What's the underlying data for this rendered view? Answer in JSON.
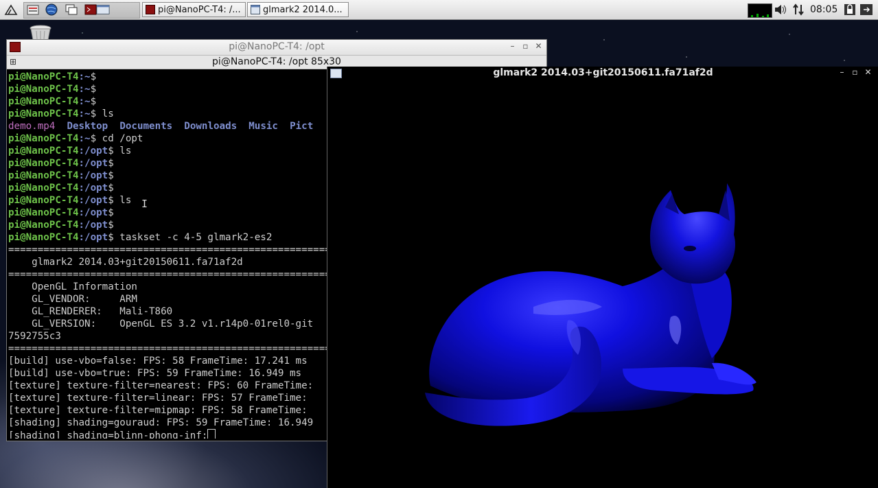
{
  "taskbar": {
    "task_buttons": [
      {
        "label": "pi@NanoPC-T4: /..."
      },
      {
        "label": "glmark2 2014.0..."
      }
    ],
    "clock": "08:05",
    "icons": [
      "start-menu-icon",
      "file-manager-icon",
      "browser-icon",
      "windows-icon",
      "terminal-icon",
      "window-switch-icon",
      "network-graph-icon",
      "volume-icon",
      "network-icon",
      "lock-icon",
      "power-icon"
    ]
  },
  "terminal": {
    "title": "pi@NanoPC-T4: /opt",
    "subtitle": "pi@NanoPC-T4: /opt 85x30",
    "lines": [
      {
        "host": "pi@NanoPC-T4",
        "path": ":~",
        "cmd": "$"
      },
      {
        "host": "pi@NanoPC-T4",
        "path": ":~",
        "cmd": "$"
      },
      {
        "host": "pi@NanoPC-T4",
        "path": ":~",
        "cmd": "$"
      },
      {
        "host": "pi@NanoPC-T4",
        "path": ":~",
        "cmd": "$ ls"
      }
    ],
    "ls_output": [
      "demo.mp4",
      "Desktop",
      "Documents",
      "Downloads",
      "Music",
      "Pict"
    ],
    "lines2": [
      {
        "host": "pi@NanoPC-T4",
        "path": ":~",
        "cmd": "$ cd /opt"
      },
      {
        "host": "pi@NanoPC-T4",
        "path": ":/opt",
        "cmd": "$ ls"
      },
      {
        "host": "pi@NanoPC-T4",
        "path": ":/opt",
        "cmd": "$"
      },
      {
        "host": "pi@NanoPC-T4",
        "path": ":/opt",
        "cmd": "$"
      },
      {
        "host": "pi@NanoPC-T4",
        "path": ":/opt",
        "cmd": "$"
      },
      {
        "host": "pi@NanoPC-T4",
        "path": ":/opt",
        "cmd": "$ ls"
      },
      {
        "host": "pi@NanoPC-T4",
        "path": ":/opt",
        "cmd": "$"
      },
      {
        "host": "pi@NanoPC-T4",
        "path": ":/opt",
        "cmd": "$"
      },
      {
        "host": "pi@NanoPC-T4",
        "path": ":/opt",
        "cmd": "$ taskset -c 4-5 glmark2-es2"
      }
    ],
    "output": [
      "=======================================================",
      "    glmark2 2014.03+git20150611.fa71af2d",
      "=======================================================",
      "    OpenGL Information",
      "    GL_VENDOR:     ARM",
      "    GL_RENDERER:   Mali-T860",
      "    GL_VERSION:    OpenGL ES 3.2 v1.r14p0-01rel0-git",
      "7592755c3",
      "=======================================================",
      "[build] use-vbo=false: FPS: 58 FrameTime: 17.241 ms",
      "[build] use-vbo=true: FPS: 59 FrameTime: 16.949 ms",
      "[texture] texture-filter=nearest: FPS: 60 FrameTime:",
      "[texture] texture-filter=linear: FPS: 57 FrameTime:",
      "[texture] texture-filter=mipmap: FPS: 58 FrameTime:",
      "[shading] shading=gouraud: FPS: 59 FrameTime: 16.949"
    ],
    "last_line": "[shading] shading=blinn-phong-inf:"
  },
  "glmark": {
    "title": "glmark2 2014.03+git20150611.fa71af2d",
    "model": "cat",
    "model_color": "#1010ee"
  }
}
